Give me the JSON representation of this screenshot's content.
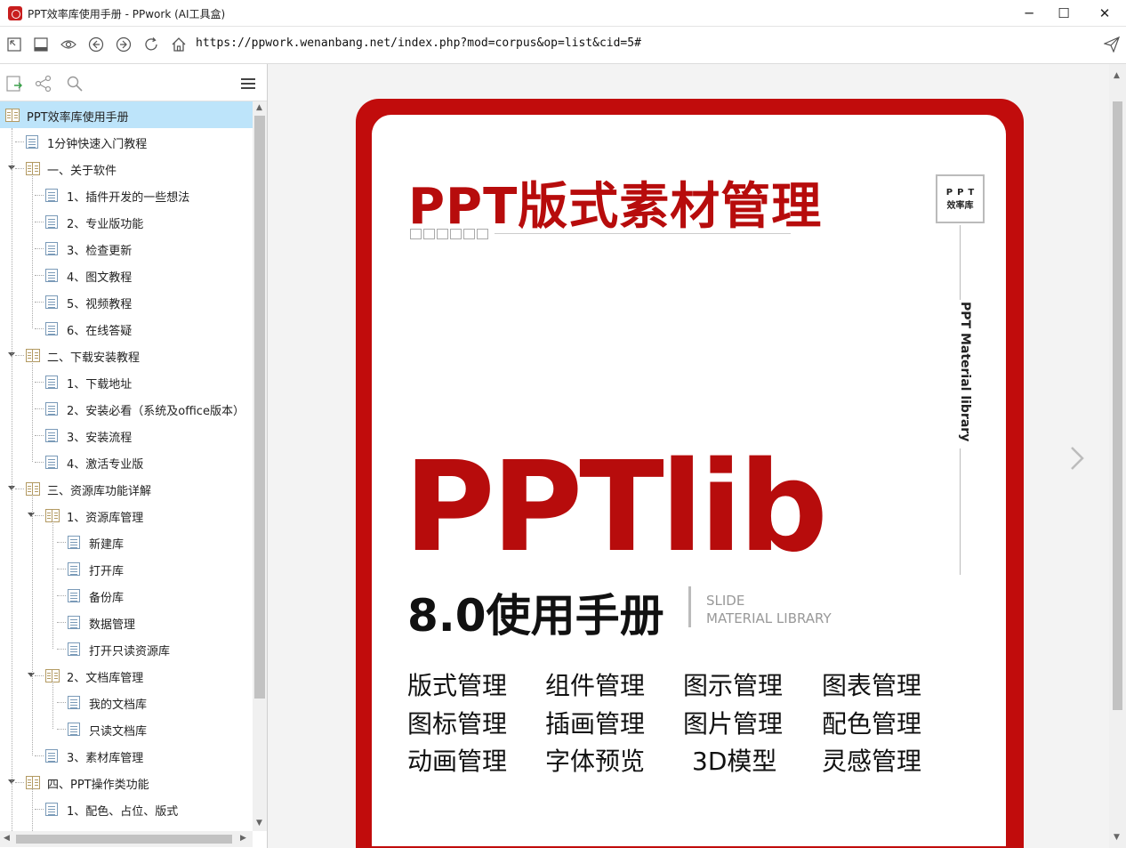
{
  "window": {
    "title": "PPT效率库使用手册 - PPwork (AI工具盒)",
    "minimize": "─",
    "maximize": "☐",
    "close": "✕"
  },
  "address": {
    "url": "https://ppwork.wenanbang.net/index.php?mod=corpus&op=list&cid=5#"
  },
  "sidebar": {
    "menu_icon": "menu-icon",
    "tree": [
      {
        "label": "PPT效率库使用手册",
        "type": "book",
        "level": 0,
        "selected": true
      },
      {
        "label": "1分钟快速入门教程",
        "type": "doc",
        "level": 1
      },
      {
        "label": "一、关于软件",
        "type": "book",
        "level": 1,
        "expanded": true
      },
      {
        "label": "1、插件开发的一些想法",
        "type": "doc",
        "level": 2
      },
      {
        "label": "2、专业版功能",
        "type": "doc",
        "level": 2
      },
      {
        "label": "3、检查更新",
        "type": "doc",
        "level": 2
      },
      {
        "label": "4、图文教程",
        "type": "doc",
        "level": 2
      },
      {
        "label": "5、视频教程",
        "type": "doc",
        "level": 2
      },
      {
        "label": "6、在线答疑",
        "type": "doc",
        "level": 2
      },
      {
        "label": "二、下载安装教程",
        "type": "book",
        "level": 1,
        "expanded": true
      },
      {
        "label": "1、下载地址",
        "type": "doc",
        "level": 2
      },
      {
        "label": "2、安装必看（系统及office版本）",
        "type": "doc",
        "level": 2
      },
      {
        "label": "3、安装流程",
        "type": "doc",
        "level": 2
      },
      {
        "label": "4、激活专业版",
        "type": "doc",
        "level": 2
      },
      {
        "label": "三、资源库功能详解",
        "type": "book",
        "level": 1,
        "expanded": true
      },
      {
        "label": "1、资源库管理",
        "type": "book",
        "level": 2,
        "expanded": true
      },
      {
        "label": "新建库",
        "type": "doc",
        "level": 3
      },
      {
        "label": "打开库",
        "type": "doc",
        "level": 3
      },
      {
        "label": "备份库",
        "type": "doc",
        "level": 3
      },
      {
        "label": "数据管理",
        "type": "doc",
        "level": 3
      },
      {
        "label": "打开只读资源库",
        "type": "doc",
        "level": 3
      },
      {
        "label": "2、文档库管理",
        "type": "book",
        "level": 2,
        "expanded": true
      },
      {
        "label": "我的文档库",
        "type": "doc",
        "level": 3
      },
      {
        "label": "只读文档库",
        "type": "doc",
        "level": 3
      },
      {
        "label": "3、素材库管理",
        "type": "doc",
        "level": 2
      },
      {
        "label": "四、PPT操作类功能",
        "type": "book",
        "level": 1,
        "expanded": true
      },
      {
        "label": "1、配色、占位、版式",
        "type": "doc",
        "level": 2
      }
    ]
  },
  "cover": {
    "title": "PPT版式素材管理",
    "badge_line1": "PPT",
    "badge_line2": "效率库",
    "vertical_text": "PPT Material library",
    "logo": "PPTlib",
    "subtitle": "8.0使用手册",
    "slide_line1": "SLIDE",
    "slide_line2": "MATERIAL LIBRARY",
    "features": [
      "版式管理",
      "组件管理",
      "图示管理",
      "图表管理",
      "图标管理",
      "插画管理",
      "图片管理",
      "配色管理",
      "动画管理",
      "字体预览",
      "3D模型",
      "灵感管理"
    ],
    "accent_color": "#b70c0c"
  }
}
